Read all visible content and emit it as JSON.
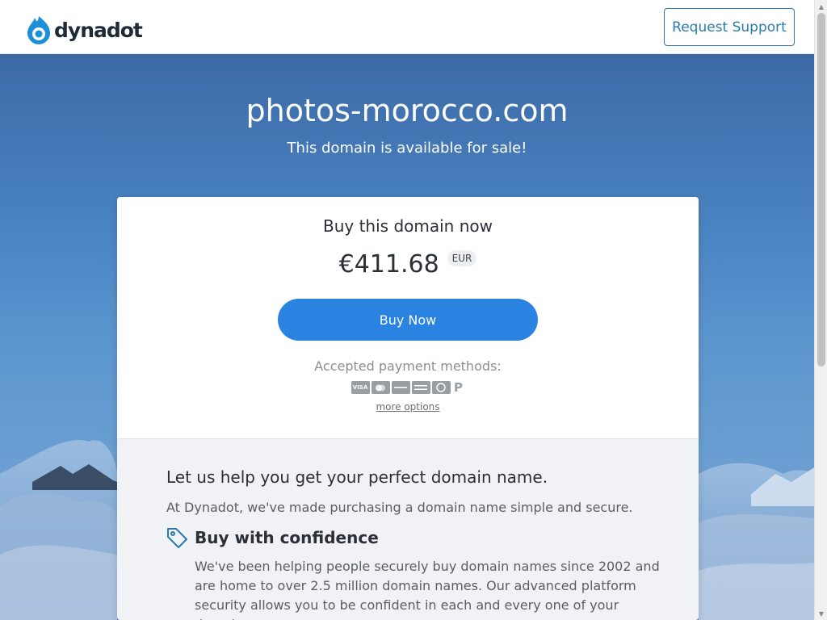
{
  "header": {
    "logo_text": "dynadot",
    "support_label": "Request Support"
  },
  "hero": {
    "domain": "photos-morocco.com",
    "subtitle": "This domain is available for sale!"
  },
  "card": {
    "buy_title": "Buy this domain now",
    "price": "€411.68",
    "currency": "EUR",
    "buy_button": "Buy Now",
    "payment_label": "Accepted payment methods:",
    "payment_icons": [
      "visa-icon",
      "mastercard-icon",
      "discover-icon",
      "amex-icon",
      "alipay-icon",
      "paypal-icon"
    ],
    "payment_icon_labels": [
      "VISA",
      "",
      "",
      "",
      "",
      "P"
    ],
    "more_options": "more options"
  },
  "help": {
    "title": "Let us help you get your perfect domain name.",
    "text": "At Dynadot, we've made purchasing a domain name simple and secure.",
    "confidence_title": "Buy with confidence",
    "confidence_text": "We've been helping people securely buy domain names since 2002 and are home to over 2.5 million domain names. Our advanced platform security allows you to be confident in each and every one of your domain"
  },
  "colors": {
    "brand": "#2a7ab0",
    "button": "#2a83e0",
    "hero_top": "#3c6aa6",
    "hero_bottom": "#5d8cc3"
  }
}
